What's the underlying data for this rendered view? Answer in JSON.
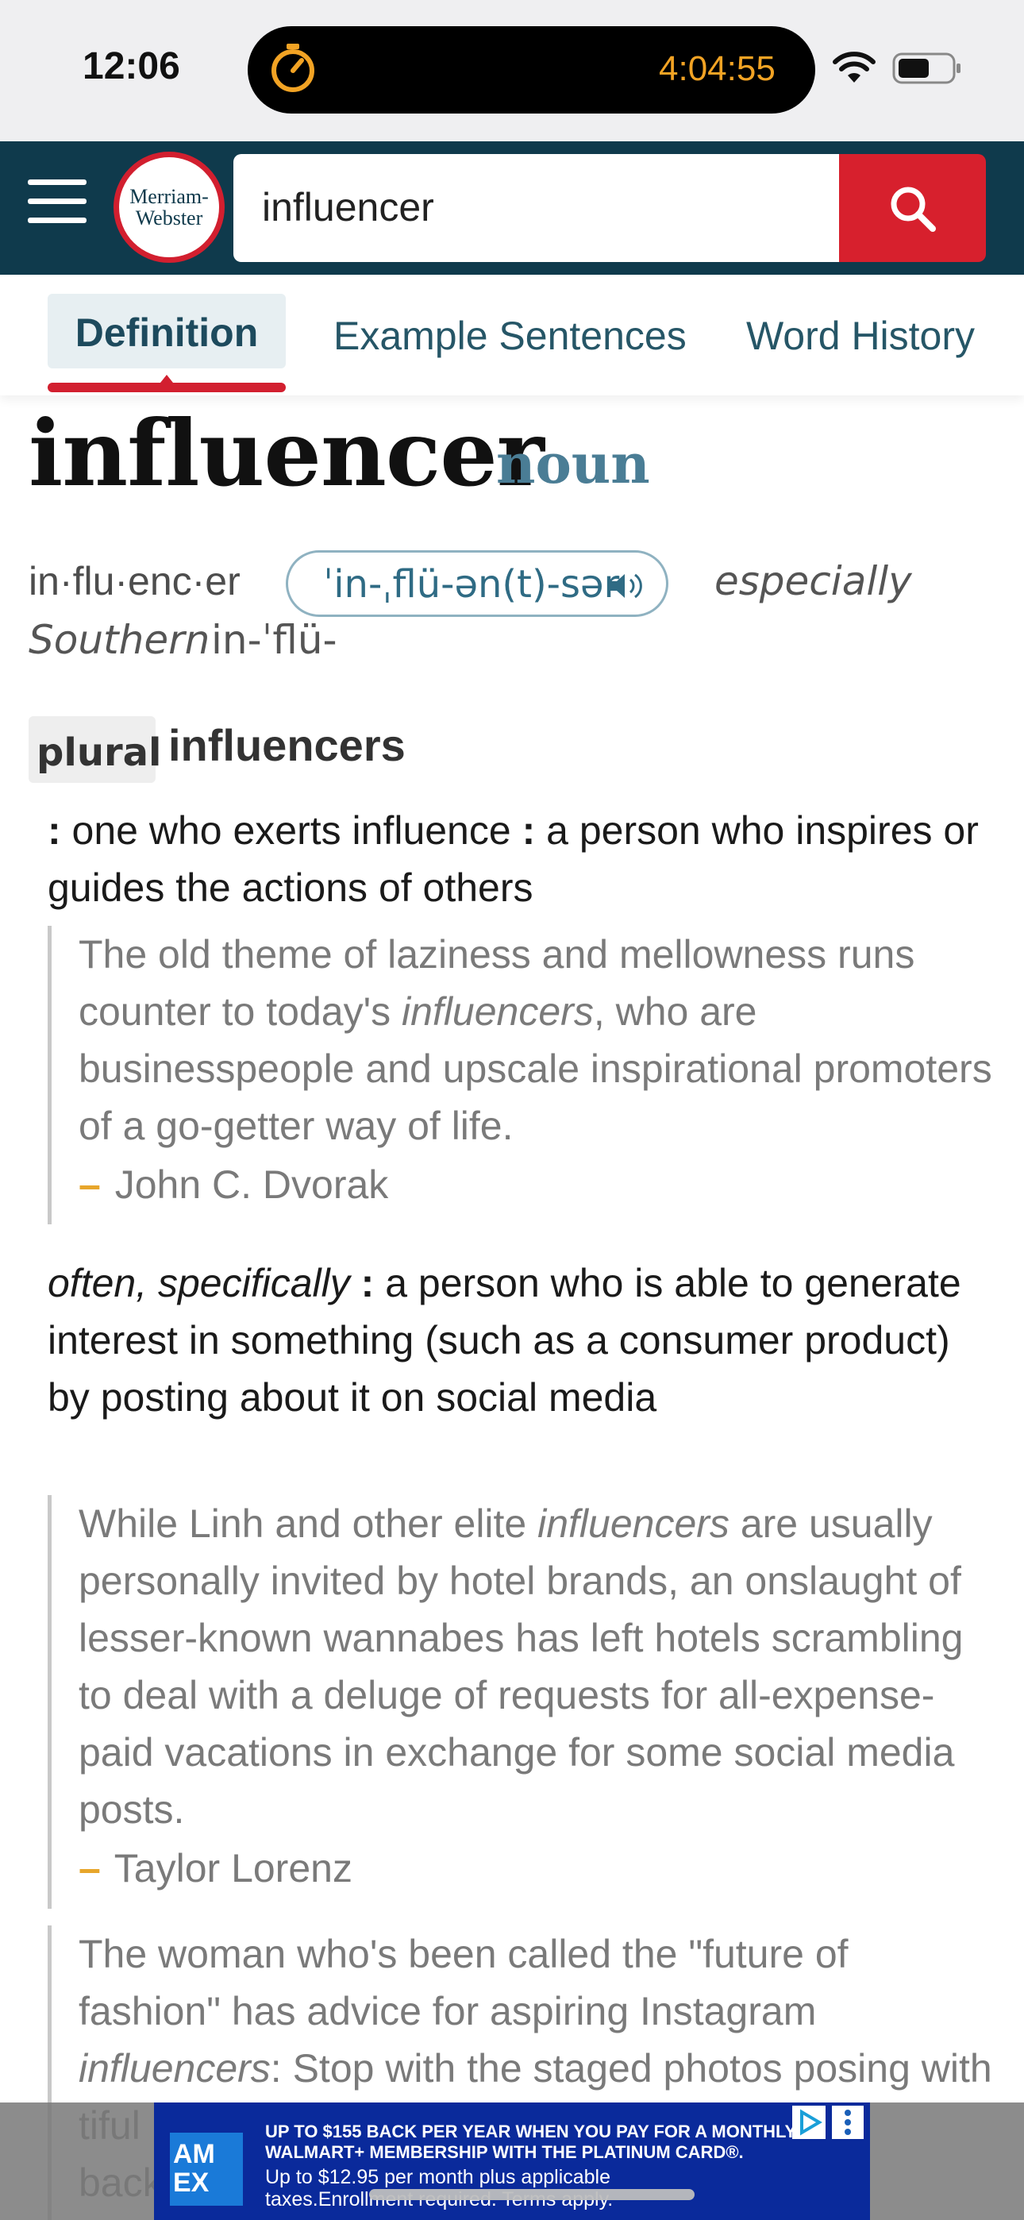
{
  "status_bar": {
    "time": "12:06",
    "timer": "4:04:55"
  },
  "header": {
    "logo_line1": "Merriam-",
    "logo_line2": "Webster",
    "search_value": "influencer"
  },
  "tabs": [
    {
      "label": "Definition"
    },
    {
      "label": "Example Sentences"
    },
    {
      "label": "Word History"
    }
  ],
  "entry": {
    "headword": "influencer",
    "part_of_speech": "noun",
    "syllables": "in·flu·enc·er",
    "pronunciation": "ˈin-ˌflü-ən(t)-sər",
    "variant_label": "especially",
    "variant_region": "Southern",
    "variant_pronunciation": "in-ˈflü-",
    "plural_label": "plural",
    "plural_form": "influencers"
  },
  "senses": [
    {
      "colon": ":",
      "text1": " one who exerts influence ",
      "colon2": ":",
      "text2": " a person who inspires or guides the actions of others"
    },
    {
      "label": "often, specifically",
      "colon": " :",
      "text": " a person who is able to generate interest in something (such as a consumer product) by posting about it on social media"
    }
  ],
  "quotes": [
    {
      "pre": "The old theme of laziness and mellowness runs counter to today's ",
      "italic": "influencers",
      "post": ", who are businesspeople and upscale inspirational promoters of a go-getter way of life.",
      "dash": "–",
      "author": " John C. Dvorak"
    },
    {
      "pre": "While Linh and other elite ",
      "italic": "influencers",
      "post": " are usually personally invited by hotel brands, an onslaught of lesser-known wannabes has left hotels scrambling to deal with a deluge of requests for all-expense-paid vacations in exchange for some social media posts.",
      "dash": "–",
      "author": " Taylor Lorenz"
    },
    {
      "pre": "The woman who's been called the \"future of fashion\" has advice for aspiring Instagram ",
      "italic": "influencers",
      "post": ": Stop with the staged photos posing with",
      "post2": "tiful",
      "post3": "back"
    }
  ],
  "ad": {
    "logo_line1": "AM",
    "logo_line2": "EX",
    "line1": "UP TO $155 BACK PER YEAR WHEN YOU PAY FOR A MONTHLY",
    "line2": "WALMART+ MEMBERSHIP WITH THE PLATINUM CARD®.",
    "line3": "Up to $12.95 per month plus applicable",
    "line4": "taxes.Enrollment required. Terms apply."
  },
  "colors": {
    "header_bg": "#0f3a4c",
    "brand_red": "#d21f2f",
    "link_blue": "#265667",
    "timer_orange": "#f2a324"
  }
}
